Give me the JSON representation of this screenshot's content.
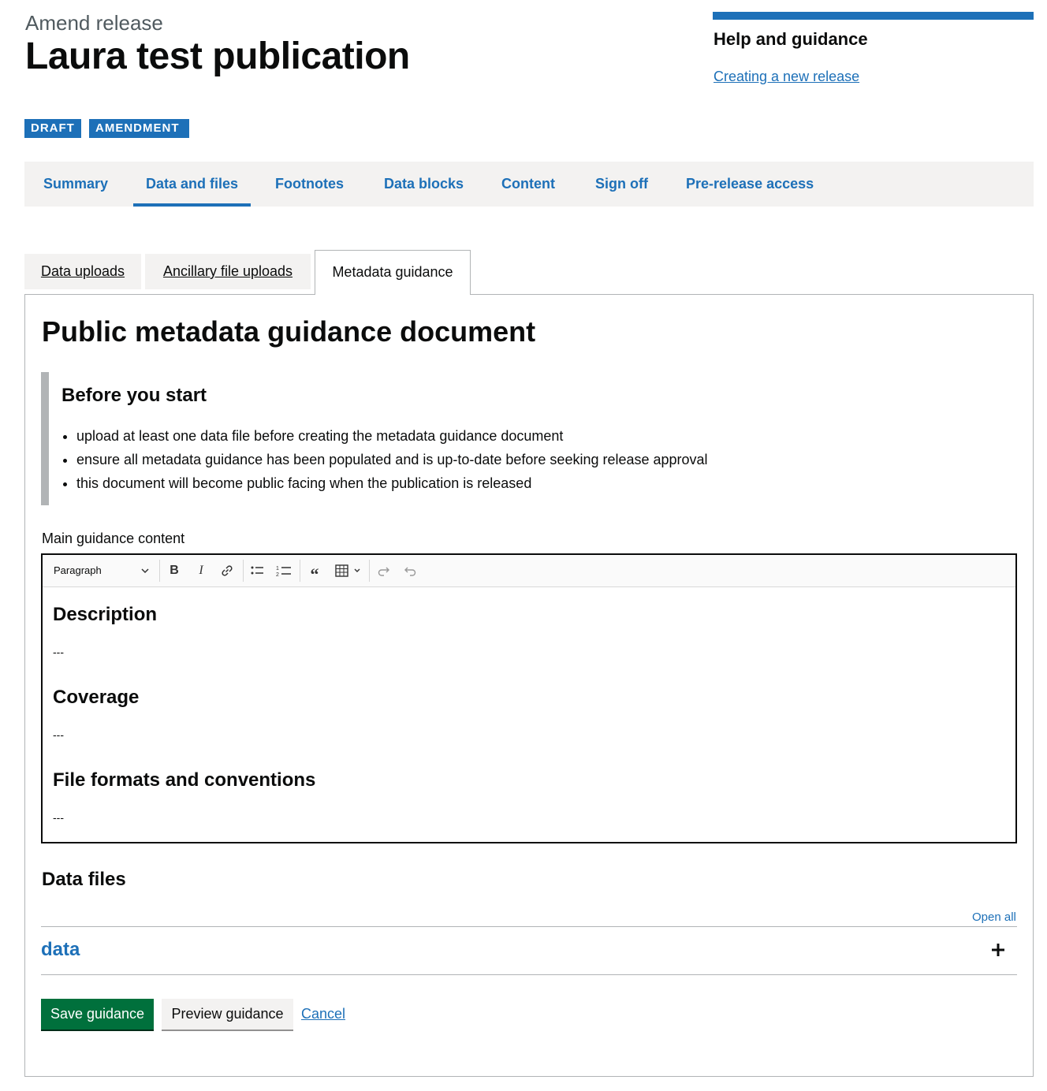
{
  "header": {
    "caption": "Amend release",
    "title": "Laura test publication"
  },
  "help": {
    "title": "Help and guidance",
    "link": "Creating a new release"
  },
  "tags": {
    "draft": "DRAFT",
    "amendment": "AMENDMENT"
  },
  "nav": {
    "items": [
      "Summary",
      "Data and files",
      "Footnotes",
      "Data blocks",
      "Content",
      "Sign off",
      "Pre-release access"
    ],
    "active": "Data and files"
  },
  "tabs": {
    "items": [
      "Data uploads",
      "Ancillary file uploads",
      "Metadata guidance"
    ],
    "active": "Metadata guidance"
  },
  "panel": {
    "title": "Public metadata guidance document",
    "inset": {
      "title": "Before you start",
      "bullets": [
        "upload at least one data file before creating the metadata guidance document",
        "ensure all metadata guidance has been populated and is up-to-date before seeking release approval",
        "this document will become public facing when the publication is released"
      ]
    },
    "editor": {
      "label": "Main guidance content",
      "format_select": "Paragraph",
      "toolbar_icons": [
        "bold-icon",
        "italic-icon",
        "link-icon",
        "bulleted-list-icon",
        "numbered-list-icon",
        "blockquote-icon",
        "table-icon",
        "redo-icon",
        "undo-icon"
      ],
      "sections": [
        {
          "heading": "Description",
          "body": "---"
        },
        {
          "heading": "Coverage",
          "body": "---"
        },
        {
          "heading": "File formats and conventions",
          "body": "---"
        }
      ]
    },
    "data_files": {
      "title": "Data files",
      "open_all": "Open all",
      "items": [
        "data"
      ]
    },
    "actions": {
      "save": "Save guidance",
      "preview": "Preview guidance",
      "cancel": "Cancel"
    }
  },
  "colors": {
    "link": "#1d70b8",
    "tag": "#1d70b8",
    "save_button": "#00703c",
    "nav_background": "#f3f2f1"
  }
}
